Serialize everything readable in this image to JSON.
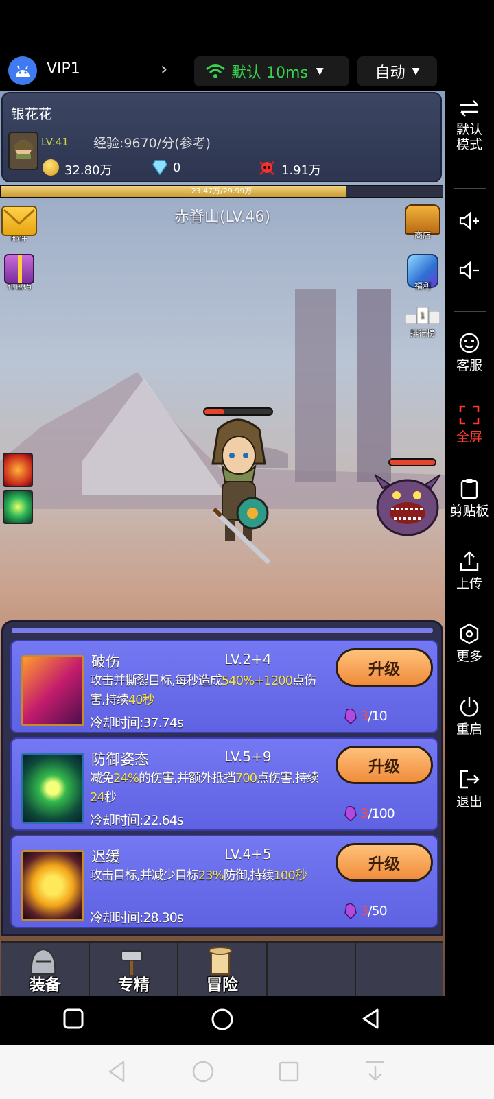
{
  "host_bar": {
    "vip_label": "VIP1",
    "network_label": "默认 10ms",
    "mode_label": "自动"
  },
  "sidebar": {
    "items": [
      {
        "label_line1": "默认",
        "label_line2": "模式",
        "icon": "swap-arrows-icon"
      },
      {
        "label": "",
        "icon": "volume-up-icon"
      },
      {
        "label": "",
        "icon": "volume-down-icon"
      },
      {
        "label": "客服",
        "icon": "support-face-icon"
      },
      {
        "label": "全屏",
        "icon": "fullscreen-icon",
        "color": "#ff3a2e"
      },
      {
        "label": "剪贴板",
        "icon": "clipboard-icon"
      },
      {
        "label": "上传",
        "icon": "upload-icon"
      },
      {
        "label": "更多",
        "icon": "more-hex-icon"
      },
      {
        "label": "重启",
        "icon": "power-icon"
      },
      {
        "label": "退出",
        "icon": "exit-icon"
      }
    ]
  },
  "player": {
    "name": "银花花",
    "level": "LV:41",
    "exp_rate": "经验:9670/分(参考)",
    "gold": "32.80万",
    "gems": "0",
    "kills": "1.91万"
  },
  "exp_bar": {
    "text": "23.47万/29.99万",
    "fraction": 0.7826
  },
  "stage": {
    "title": "赤脊山(LV.46)"
  },
  "left_icons": {
    "mail": "邮件",
    "gift_code": "礼包码"
  },
  "right_icons": {
    "shop": "商店",
    "welfare": "福利",
    "leaderboard": "排行榜"
  },
  "battle": {
    "player_hp_fraction": 0.3,
    "enemy_hp_fraction": 1.0
  },
  "skills": [
    {
      "name": "破伤",
      "level": "LV.2+4",
      "desc_parts": [
        "攻击并撕裂目标,每秒造成",
        "540%+1200",
        "点伤害,持续",
        "40秒"
      ],
      "cooldown": "冷却时间:37.74s",
      "button": "升级",
      "cost_have": "3",
      "cost_need": "/10",
      "icon": "rend-skill-icon"
    },
    {
      "name": "防御姿态",
      "level": "LV.5+9",
      "desc_parts": [
        "减免",
        "24%",
        "的伤害,并额外抵挡",
        "700",
        "点伤害,持续",
        "24",
        "秒"
      ],
      "cooldown": "冷却时间:22.64s",
      "button": "升级",
      "cost_have": "3",
      "cost_need": "/100",
      "icon": "defense-stance-icon"
    },
    {
      "name": "迟缓",
      "level": "LV.4+5",
      "desc_parts": [
        "攻击目标,并减少目标",
        "23%",
        "防御,持续",
        "100秒"
      ],
      "cooldown": "冷却时间:28.30s",
      "button": "升级",
      "cost_have": "3",
      "cost_need": "/50",
      "icon": "slow-skull-icon"
    }
  ],
  "tabs": [
    {
      "label": "装备",
      "icon": "helmet-icon"
    },
    {
      "label": "专精",
      "icon": "hammer-icon"
    },
    {
      "label": "冒险",
      "icon": "scroll-icon"
    },
    {
      "label": "",
      "icon": ""
    },
    {
      "label": "",
      "icon": ""
    }
  ],
  "colors": {
    "accent_green": "#37d24e",
    "highlight_yellow": "#f4e34c",
    "button_orange": "#f08c3c",
    "skill_card_blue": "#6a6ef0",
    "fullscreen_red": "#ff3a2e"
  }
}
